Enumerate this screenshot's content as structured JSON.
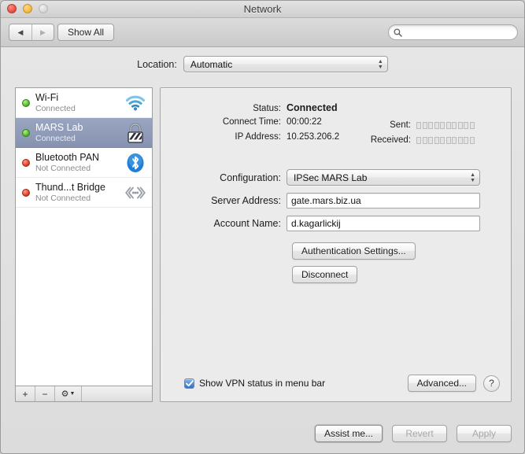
{
  "window": {
    "title": "Network",
    "controls": {
      "close": "close-button",
      "minimize": "minimize-button",
      "zoom": "zoom-button"
    }
  },
  "toolbar": {
    "back_icon": "◀",
    "forward_icon": "▶",
    "show_all_label": "Show All",
    "search_placeholder": "",
    "search_value": ""
  },
  "location": {
    "label": "Location:",
    "selected": "Automatic"
  },
  "sidebar": {
    "interfaces": [
      {
        "name": "Wi-Fi",
        "status": "Connected",
        "state": "green",
        "icon": "wifi-icon",
        "selected": false
      },
      {
        "name": "MARS Lab",
        "status": "Connected",
        "state": "green",
        "icon": "vpn-lock-icon",
        "selected": true
      },
      {
        "name": "Bluetooth PAN",
        "status": "Not Connected",
        "state": "red",
        "icon": "bluetooth-icon",
        "selected": false
      },
      {
        "name": "Thund...t Bridge",
        "status": "Not Connected",
        "state": "red",
        "icon": "thunderbolt-icon",
        "selected": false
      }
    ],
    "add_label": "+",
    "remove_label": "−",
    "gear_label": "⚙"
  },
  "main": {
    "info": [
      {
        "label": "Status:",
        "value": "Connected",
        "bold": true
      },
      {
        "label": "Connect Time:",
        "value": "00:00:22",
        "bold": false
      },
      {
        "label": "IP Address:",
        "value": "10.253.206.2",
        "bold": false
      }
    ],
    "meters": [
      {
        "label": "Sent:",
        "segments": 10,
        "active": 0
      },
      {
        "label": "Received:",
        "segments": 10,
        "active": 0
      }
    ],
    "fields": {
      "configuration_label": "Configuration:",
      "configuration_value": "IPSec MARS Lab",
      "server_address_label": "Server Address:",
      "server_address_value": "gate.mars.biz.ua",
      "account_name_label": "Account Name:",
      "account_name_value": "d.kagarlickij"
    },
    "auth_settings_label": "Authentication Settings...",
    "disconnect_label": "Disconnect",
    "show_vpn_label": "Show VPN status in menu bar",
    "show_vpn_checked": true,
    "advanced_label": "Advanced...",
    "help_label": "?"
  },
  "footer": {
    "assist_label": "Assist me...",
    "revert_label": "Revert",
    "revert_disabled": true,
    "apply_label": "Apply",
    "apply_disabled": true
  },
  "colors": {
    "selection": "#8692b0",
    "accent_blue": "#2d74c9",
    "status_green": "#4fb82a",
    "status_red": "#e03a22"
  }
}
